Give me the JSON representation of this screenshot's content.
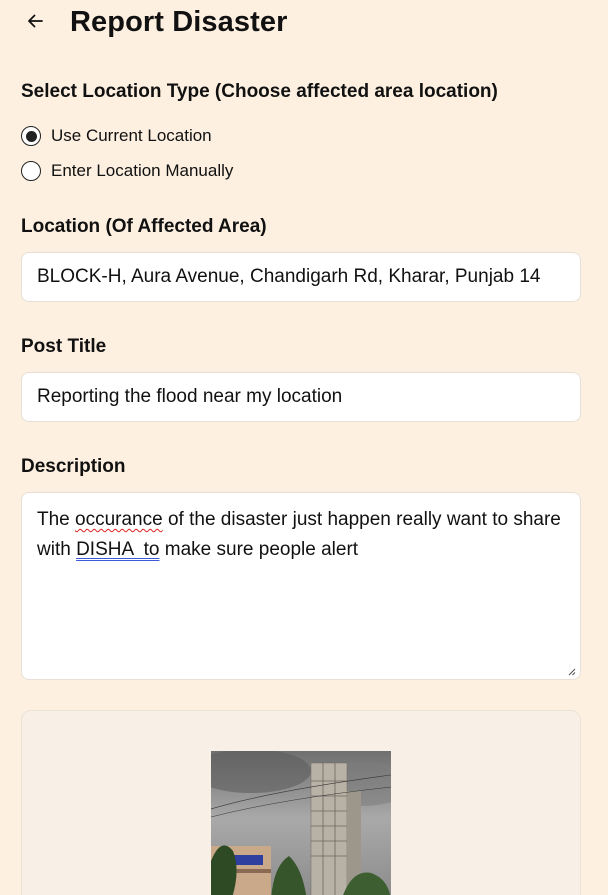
{
  "header": {
    "back_icon": "arrow-left-icon",
    "title": "Report Disaster"
  },
  "location_type": {
    "label": "Select Location Type (Choose affected area location)",
    "options": [
      {
        "label": "Use Current Location",
        "selected": true
      },
      {
        "label": "Enter Location Manually",
        "selected": false
      }
    ]
  },
  "location": {
    "label": "Location (Of Affected Area)",
    "value": "BLOCK-H, Aura Avenue, Chandigarh Rd, Kharar, Punjab 14"
  },
  "post_title": {
    "label": "Post Title",
    "value": "Reporting the flood near my location"
  },
  "description": {
    "label": "Description",
    "text_part1": "The ",
    "text_misspelled": "occurance",
    "text_part2": " of the disaster just happen really want to share with ",
    "text_flagged": "DISHA  to",
    "text_part3": " make sure people alert"
  },
  "upload": {
    "preview_icon": "uploaded-photo-preview"
  },
  "colors": {
    "background": "#fdf0e1",
    "field_background": "#ffffff",
    "upload_background": "#f8f0e6",
    "spell_error": "#e02020",
    "grammar_flag": "#3b5bd6"
  }
}
